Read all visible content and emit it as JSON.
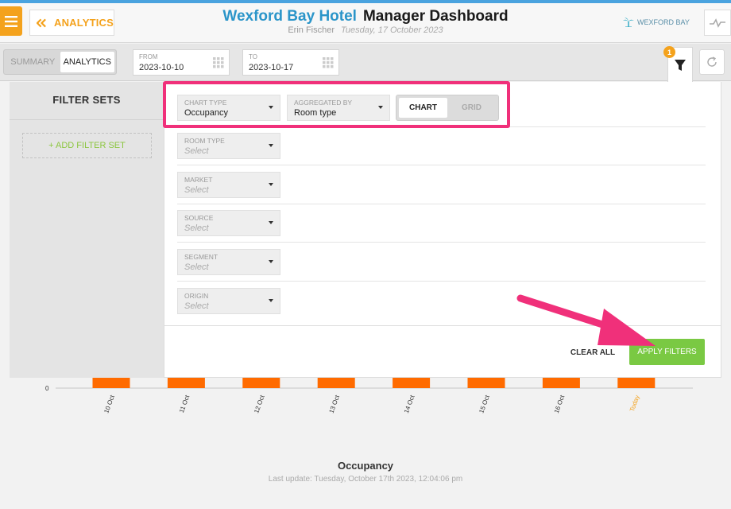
{
  "header": {
    "back_label": "ANALYTICS",
    "hotel_name": "Wexford Bay Hotel",
    "dashboard_title": "Manager Dashboard",
    "user_name": "Erin Fischer",
    "date": "Tuesday, 17 October 2023",
    "brand_label": "WEXFORD BAY"
  },
  "toolbar": {
    "tabs": [
      "SUMMARY",
      "ANALYTICS"
    ],
    "active_tab": "ANALYTICS",
    "from_label": "FROM",
    "from_value": "2023-10-10",
    "to_label": "TO",
    "to_value": "2023-10-17",
    "filter_badge": "1"
  },
  "filter_sets": {
    "title": "FILTER SETS",
    "add_label": "+ ADD FILTER SET"
  },
  "filters": {
    "chart_type": {
      "label": "CHART TYPE",
      "value": "Occupancy"
    },
    "aggregated_by": {
      "label": "AGGREGATED BY",
      "value": "Room type"
    },
    "view_toggle": {
      "options": [
        "CHART",
        "GRID"
      ],
      "active": "CHART"
    },
    "room_type": {
      "label": "ROOM TYPE",
      "placeholder": "Select"
    },
    "market": {
      "label": "MARKET",
      "placeholder": "Select"
    },
    "source": {
      "label": "SOURCE",
      "placeholder": "Select"
    },
    "segment": {
      "label": "SEGMENT",
      "placeholder": "Select"
    },
    "origin": {
      "label": "ORIGIN",
      "placeholder": "Select"
    },
    "clear_label": "CLEAR ALL",
    "apply_label": "APPLY FILTERS"
  },
  "chart_data": {
    "type": "bar",
    "title": "Occupancy",
    "categories": [
      "10 Oct",
      "11 Oct",
      "12 Oct",
      "13 Oct",
      "14 Oct",
      "15 Oct",
      "16 Oct",
      "Today"
    ],
    "y_tick_visible": "0",
    "bar_color": "#ff6b00",
    "today_label_color": "#f4a21c"
  },
  "status": {
    "last_update": "Last update: Tuesday, October 17th 2023, 12:04:06 pm"
  },
  "colors": {
    "accent_orange": "#f4a21c",
    "hotel_blue": "#2b95c9",
    "apply_green": "#7ac943",
    "highlight_pink": "#f0307a"
  }
}
